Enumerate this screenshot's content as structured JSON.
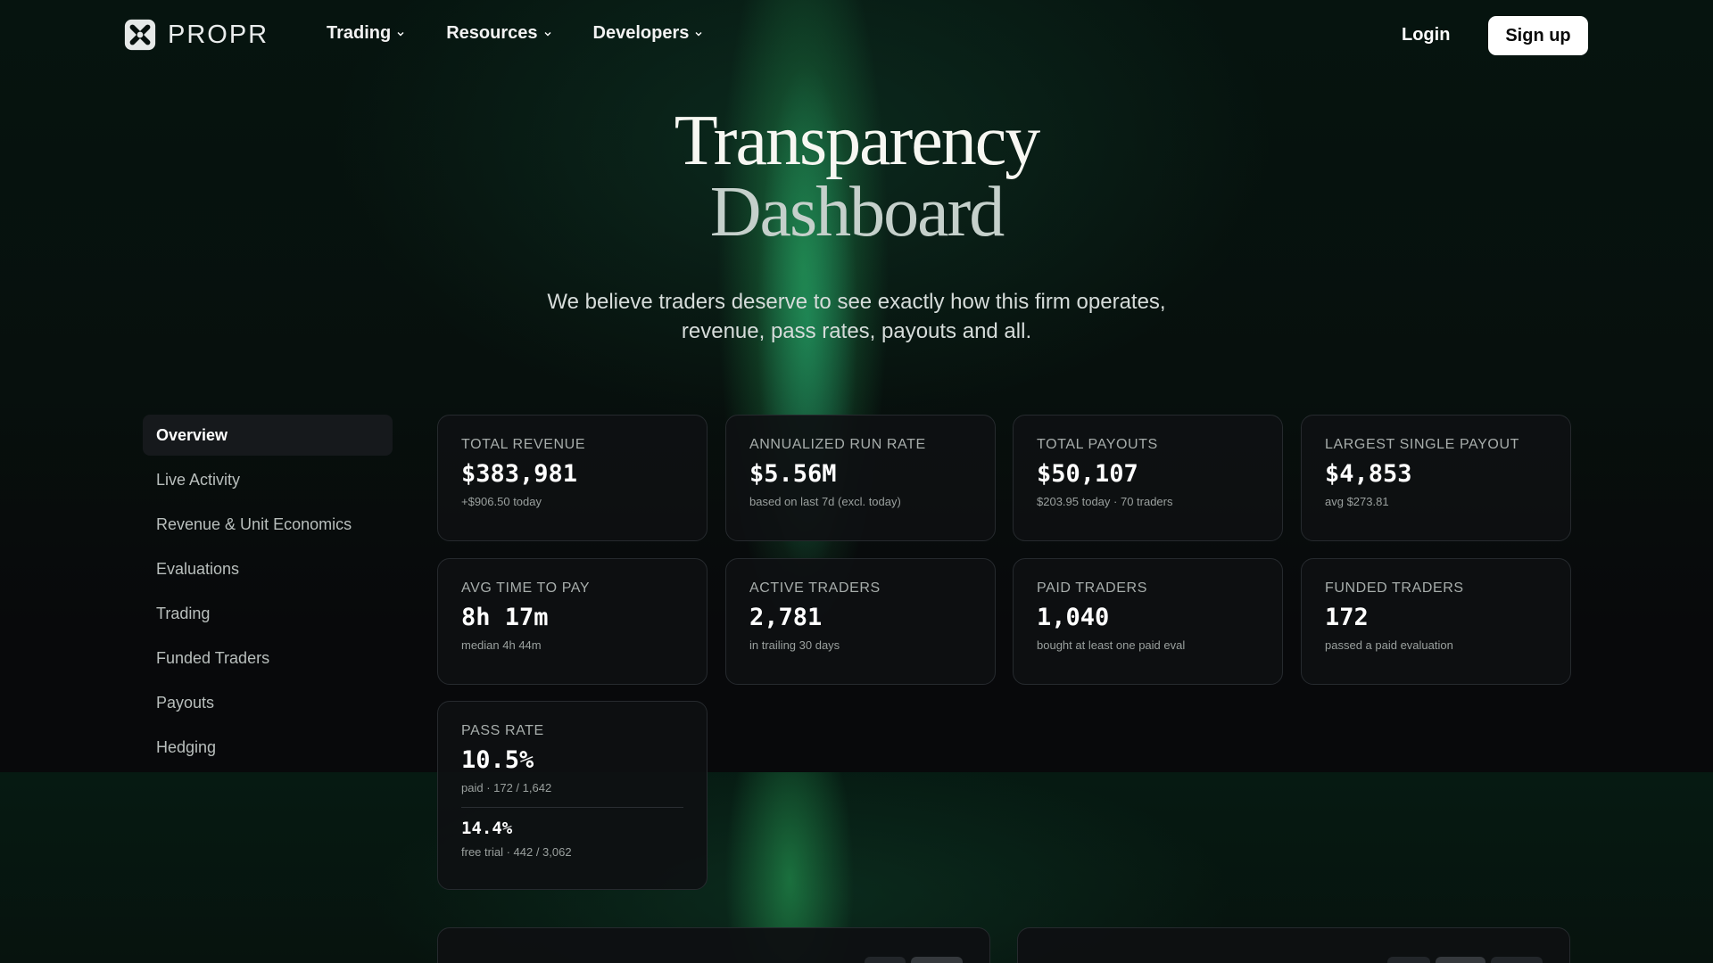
{
  "brand": {
    "name": "PROPR"
  },
  "nav": {
    "items": [
      {
        "label": "Trading"
      },
      {
        "label": "Resources"
      },
      {
        "label": "Developers"
      }
    ],
    "login": "Login",
    "signup": "Sign up"
  },
  "hero": {
    "title_line1": "Transparency",
    "title_line2": "Dashboard",
    "subtitle_line1": "We believe traders deserve to see exactly how this firm operates,",
    "subtitle_line2": "revenue, pass rates, payouts and all."
  },
  "sidebar": {
    "items": [
      {
        "label": "Overview",
        "active": true
      },
      {
        "label": "Live Activity"
      },
      {
        "label": "Revenue & Unit Economics"
      },
      {
        "label": "Evaluations"
      },
      {
        "label": "Trading"
      },
      {
        "label": "Funded Traders"
      },
      {
        "label": "Payouts"
      },
      {
        "label": "Hedging"
      }
    ]
  },
  "stats": [
    {
      "label": "TOTAL REVENUE",
      "value": "$383,981",
      "note": "+$906.50 today"
    },
    {
      "label": "ANNUALIZED RUN RATE",
      "value": "$5.56M",
      "note": "based on last 7d (excl. today)"
    },
    {
      "label": "TOTAL PAYOUTS",
      "value": "$50,107",
      "note": "$203.95 today · 70 traders"
    },
    {
      "label": "LARGEST SINGLE PAYOUT",
      "value": "$4,853",
      "note": "avg $273.81"
    },
    {
      "label": "AVG TIME TO PAY",
      "value": "8h 17m",
      "note": "median 4h 44m"
    },
    {
      "label": "ACTIVE TRADERS",
      "value": "2,781",
      "note": "in trailing 30 days"
    },
    {
      "label": "PAID TRADERS",
      "value": "1,040",
      "note": "bought at least one paid eval"
    },
    {
      "label": "FUNDED TRADERS",
      "value": "172",
      "note": "passed a paid evaluation"
    }
  ],
  "pass_rate": {
    "label": "PASS RATE",
    "value": "10.5%",
    "note": "paid · 172 / 1,642",
    "value2": "14.4%",
    "note2": "free trial · 442 / 3,062"
  },
  "colors": {
    "accent_green": "#2aa05a",
    "background": "#07090b",
    "card_border": "#262a2e"
  }
}
